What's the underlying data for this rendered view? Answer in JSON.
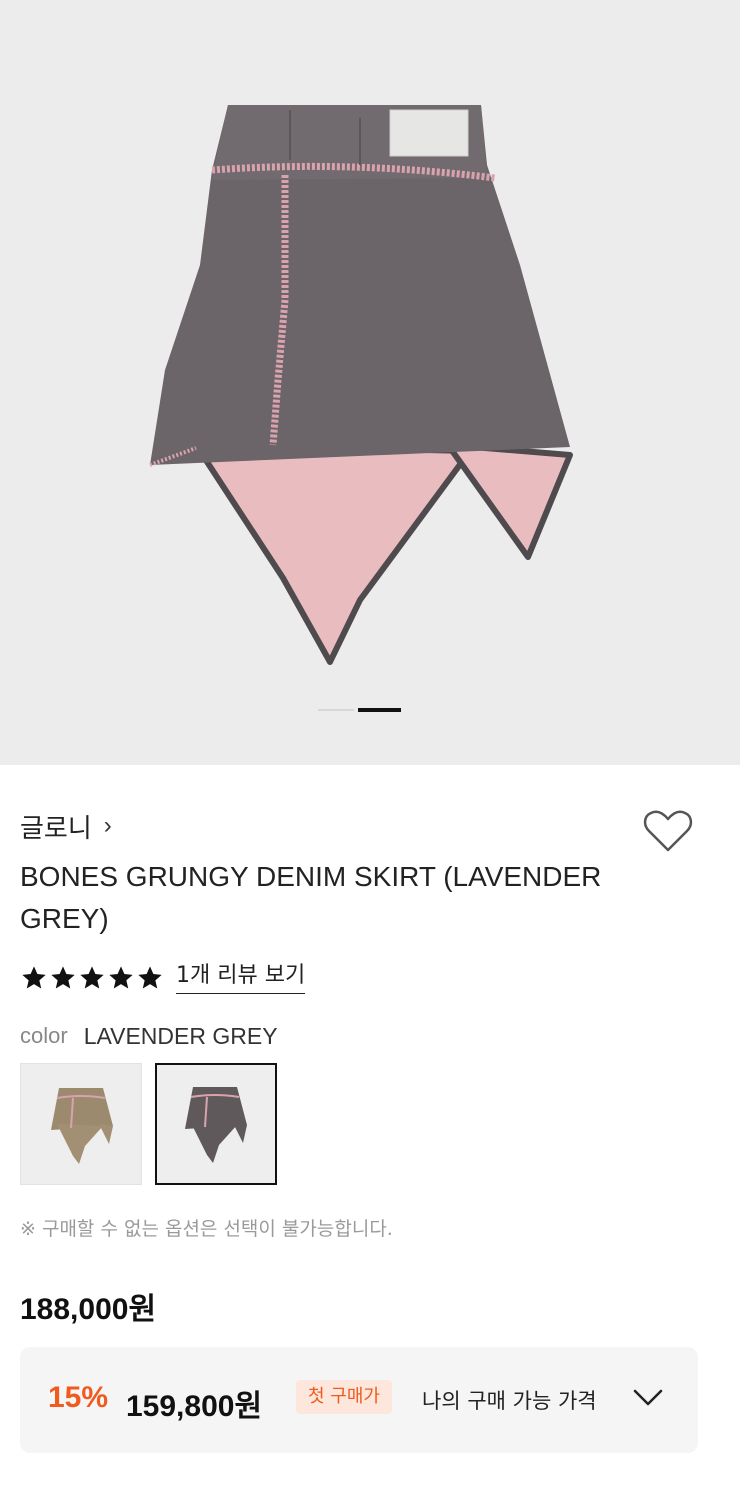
{
  "gallery": {
    "product_image": "lavender-grey-denim-skirt-photo",
    "active_slide": 2,
    "slide_count": 2
  },
  "brand": {
    "name": "글로니",
    "chevron": "›"
  },
  "product": {
    "title": "BONES GRUNGY DENIM SKIRT (LAVENDER GREY)",
    "rating": 5,
    "rating_max": 5,
    "review_link": "1개 리뷰 보기"
  },
  "option": {
    "key": "color",
    "selected_value": "LAVENDER GREY",
    "swatches": [
      {
        "name": "beige-variant",
        "selected": false
      },
      {
        "name": "lavender-grey-variant",
        "selected": true
      }
    ]
  },
  "notice": "※ 구매할 수 없는 옵션은 선택이 불가능합니다.",
  "price": {
    "original": "188,000원",
    "discount_rate": "15%",
    "discounted": "159,800원",
    "badge": "첫 구매가",
    "my_price_label": "나의 구매 가능 가격"
  },
  "colors": {
    "accent": "#f05a1e",
    "badge_bg": "#fde6dc",
    "skirt_denim": "#6b6468",
    "skirt_lining": "#e9bcc0",
    "fringe": "#d8a3ad"
  },
  "icons": {
    "wishlist": "heart-outline-icon",
    "expand": "chevron-down-icon",
    "rating": "star-icon"
  }
}
